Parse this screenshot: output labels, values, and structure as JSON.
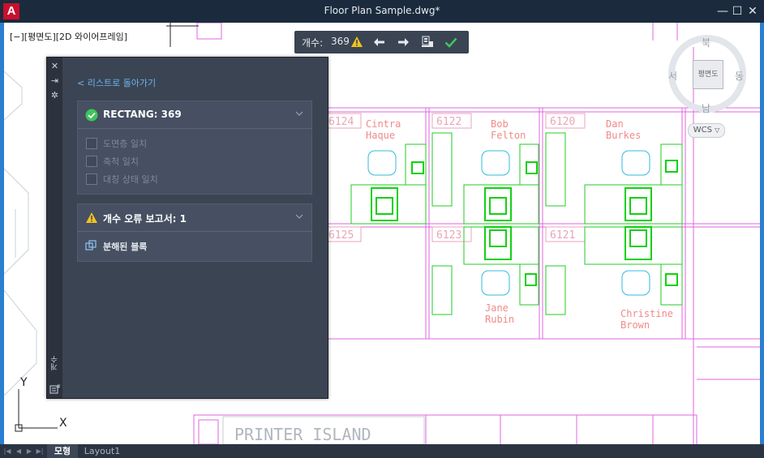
{
  "window": {
    "app_logo": "A",
    "title": "Floor Plan Sample.dwg*",
    "minimize_glyph": "—",
    "maximize_glyph": "☐",
    "close_glyph": "✕"
  },
  "viewport": {
    "view_label": "[−][평면도][2D 와이어프레임]"
  },
  "toolbar": {
    "count_label": "개수:",
    "count_value": "369",
    "icons": [
      "warning-icon",
      "previous-arrow-icon",
      "next-arrow-icon",
      "zoom-objects-icon",
      "checkmark-icon"
    ]
  },
  "panel": {
    "back_link": "< 리스트로 돌아가기",
    "vertical_title": "개수",
    "strip_icons": [
      "close-icon",
      "collapse-icon",
      "settings-icon",
      "count-table-icon"
    ],
    "card1": {
      "title": "RECTANG: 369",
      "checks": [
        {
          "label": "도면층 일치",
          "checked": false
        },
        {
          "label": "축척 일치",
          "checked": false
        },
        {
          "label": "대칭 상태 일치",
          "checked": false
        }
      ]
    },
    "card2": {
      "title": "개수 오류 보고서: 1",
      "item_label": "분해된 블록"
    }
  },
  "viewcube": {
    "north": "북",
    "south": "남",
    "east": "동",
    "west": "서",
    "face": "평면도",
    "wcs": "WCS"
  },
  "drawing": {
    "rooms": [
      "6124",
      "6122",
      "6120",
      "6125",
      "6123",
      "6121"
    ],
    "names": [
      "Cintra",
      "Haque",
      "Bob",
      "Felton",
      "Dan",
      "Burkes",
      "Jane",
      "Rubin",
      "Christine",
      "Brown"
    ],
    "printer_island": "PRINTER ISLAND",
    "ucs_x": "X",
    "ucs_y": "Y"
  },
  "tabs": {
    "model": "모형",
    "layout": "Layout1"
  },
  "colors": {
    "title_bar": "#1b2b3d",
    "frame": "#2a7fd1",
    "panel": "#3b4453",
    "wall_magenta": "#e066e0",
    "furniture_green": "#22cc22",
    "chair_cyan": "#33bbdd",
    "label_pink": "#f08a8a",
    "ok_green": "#3fc45a",
    "warning_yellow": "#f2c11f",
    "link_blue": "#6cb6f0"
  }
}
